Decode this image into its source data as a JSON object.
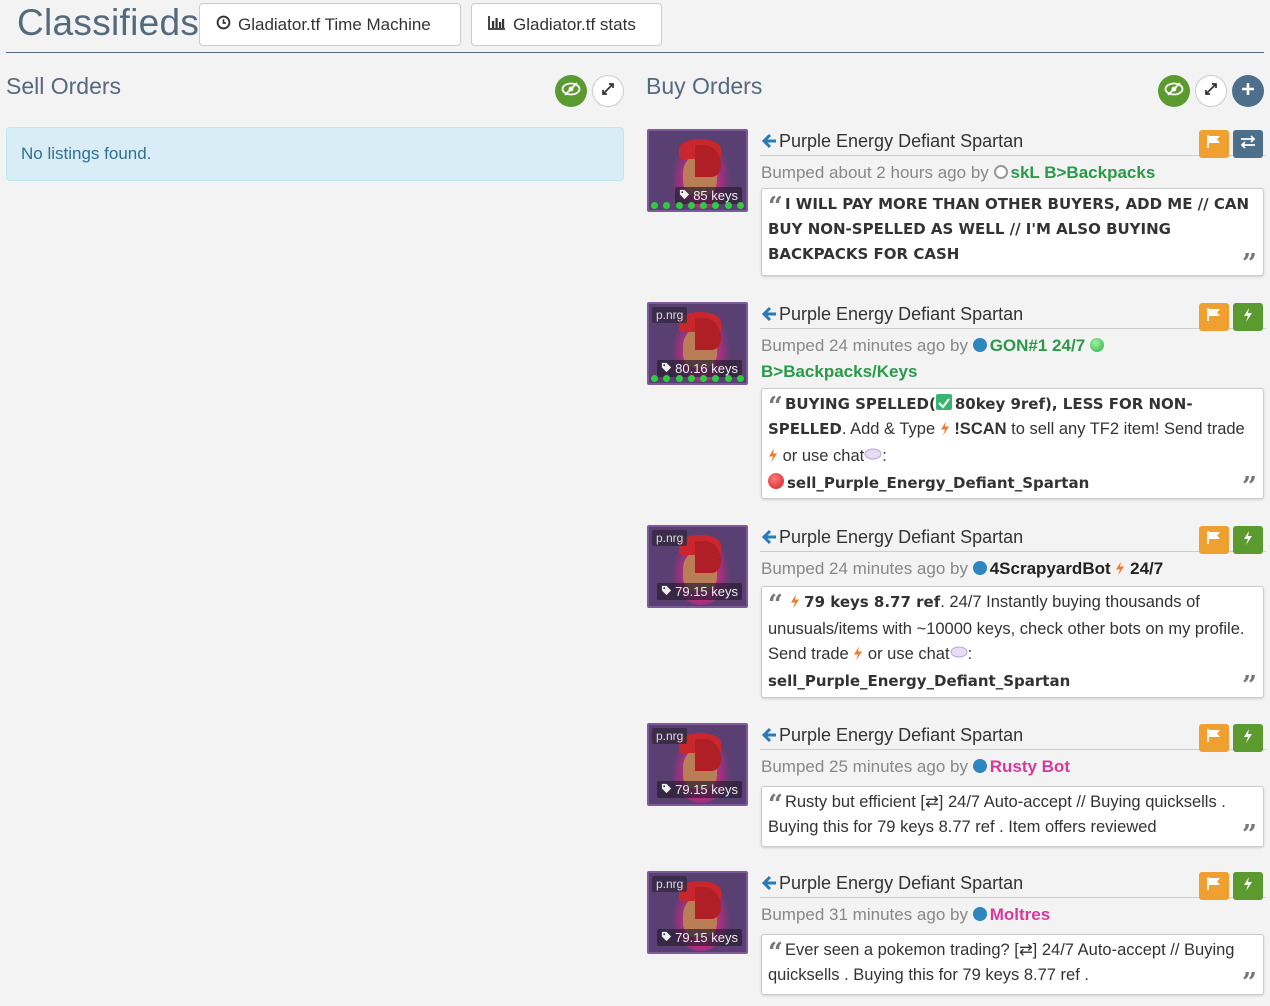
{
  "header": {
    "title": "Classifieds",
    "time_machine_label": "Gladiator.tf Time Machine",
    "stats_label": "Gladiator.tf stats"
  },
  "sell": {
    "title": "Sell Orders",
    "empty_text": "No listings found."
  },
  "buy": {
    "title": "Buy Orders"
  },
  "listings": [
    {
      "item_name": "Purple Energy Defiant Spartan",
      "price": "85 keys",
      "effect": "",
      "bumped": "Bumped about 2 hours ago by",
      "user": "skL B>Backpacks",
      "user_color": "#2a9a4a",
      "status": "offline",
      "message": "I WILL PAY MORE THAN OTHER BUYERS, ADD ME    //    CAN BUY NON-SPELLED AS WELL     //     I'M ALSO BUYING BACKPACKS FOR CASH",
      "action": "trade-offer"
    },
    {
      "item_name": "Purple Energy Defiant Spartan",
      "price": "80.16 keys",
      "effect": "p.nrg",
      "bumped": "Bumped 24 minutes ago by",
      "user": "GON#1 24/7",
      "user2": "B>Backpacks/Keys",
      "user_color": "#2a9a4a",
      "status": "online",
      "msg_a": "BUYING SPELLED(",
      "msg_b": "80key 9ref",
      "msg_c": "), LESS FOR NON-SPELLED",
      "msg_d": ". Add & Type",
      "msg_e": "!SCAN",
      "msg_f": "to sell any TF2 item! Send  trade",
      "msg_g": "or use  chat",
      "msg_h": ":",
      "msg_i": "sell_Purple_Energy_Defiant_Spartan",
      "action": "instant"
    },
    {
      "item_name": "Purple Energy Defiant Spartan",
      "price": "79.15 keys",
      "effect": "p.nrg",
      "bumped": "Bumped 24 minutes ago by",
      "user": "4ScrapyardBot",
      "user_suffix": "24/7",
      "user_color": "#222222",
      "status": "online",
      "msg_a": "79 keys 8.77 ref",
      "msg_b": ". 24/7 Instantly buying thousands of unusuals/items with ~10000 keys, check other bots on my profile. Send  trade",
      "msg_c": "or  use  chat",
      "msg_d": ":",
      "msg_e": "sell_Purple_Energy_Defiant_Spartan",
      "action": "instant"
    },
    {
      "item_name": "Purple Energy Defiant Spartan",
      "price": "79.15 keys",
      "effect": "p.nrg",
      "bumped": "Bumped 25 minutes ago by",
      "user": "Rusty Bot",
      "user_color": "#d63a9c",
      "status": "online",
      "message": "Rusty but efficient [⇄] 24/7 Auto-accept // Buying quicksells . Buying this for 79 keys 8.77 ref . Item offers reviewed",
      "action": "instant"
    },
    {
      "item_name": "Purple Energy Defiant Spartan",
      "price": "79.15 keys",
      "effect": "p.nrg",
      "bumped": "Bumped 31 minutes ago by",
      "user": "Moltres",
      "user_color": "#d63a9c",
      "status": "online",
      "message": "Ever seen a pokemon trading? [⇄] 24/7 Auto-accept // Buying quicksells . Buying this for 79 keys 8.77 ref .",
      "action": "instant"
    }
  ],
  "colors": {
    "accent_slate": "#55697d",
    "green": "#5b9a2e",
    "orange": "#f0a030",
    "info_bg": "#d9edf7"
  }
}
